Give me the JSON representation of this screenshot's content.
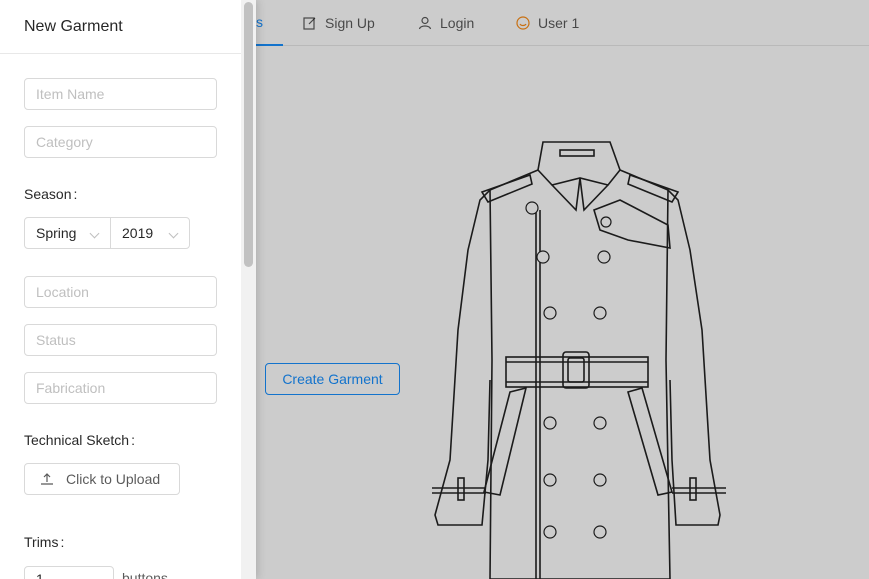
{
  "nav": {
    "items": [
      {
        "label": "s",
        "icon": "none"
      },
      {
        "label": "Sign Up",
        "icon": "edit-icon"
      },
      {
        "label": "Login",
        "icon": "user-icon"
      },
      {
        "label": "User 1",
        "icon": "smile-icon"
      }
    ]
  },
  "main": {
    "create_button": "Create Garment"
  },
  "drawer": {
    "title": "New Garment",
    "item_name_placeholder": "Item Name",
    "category_placeholder": "Category",
    "season_label": "Season",
    "season_value": "Spring",
    "year_value": "2019",
    "location_placeholder": "Location",
    "status_placeholder": "Status",
    "fabrication_placeholder": "Fabrication",
    "technical_sketch_label": "Technical Sketch",
    "upload_label": "Click to Upload",
    "trims_label": "Trims",
    "trims_value": "1",
    "trims_suffix": "buttons"
  },
  "colors": {
    "primary": "#1890ff",
    "border": "#d9d9d9",
    "placeholder": "#bfbfbf",
    "user_icon": "#fa8c16"
  }
}
